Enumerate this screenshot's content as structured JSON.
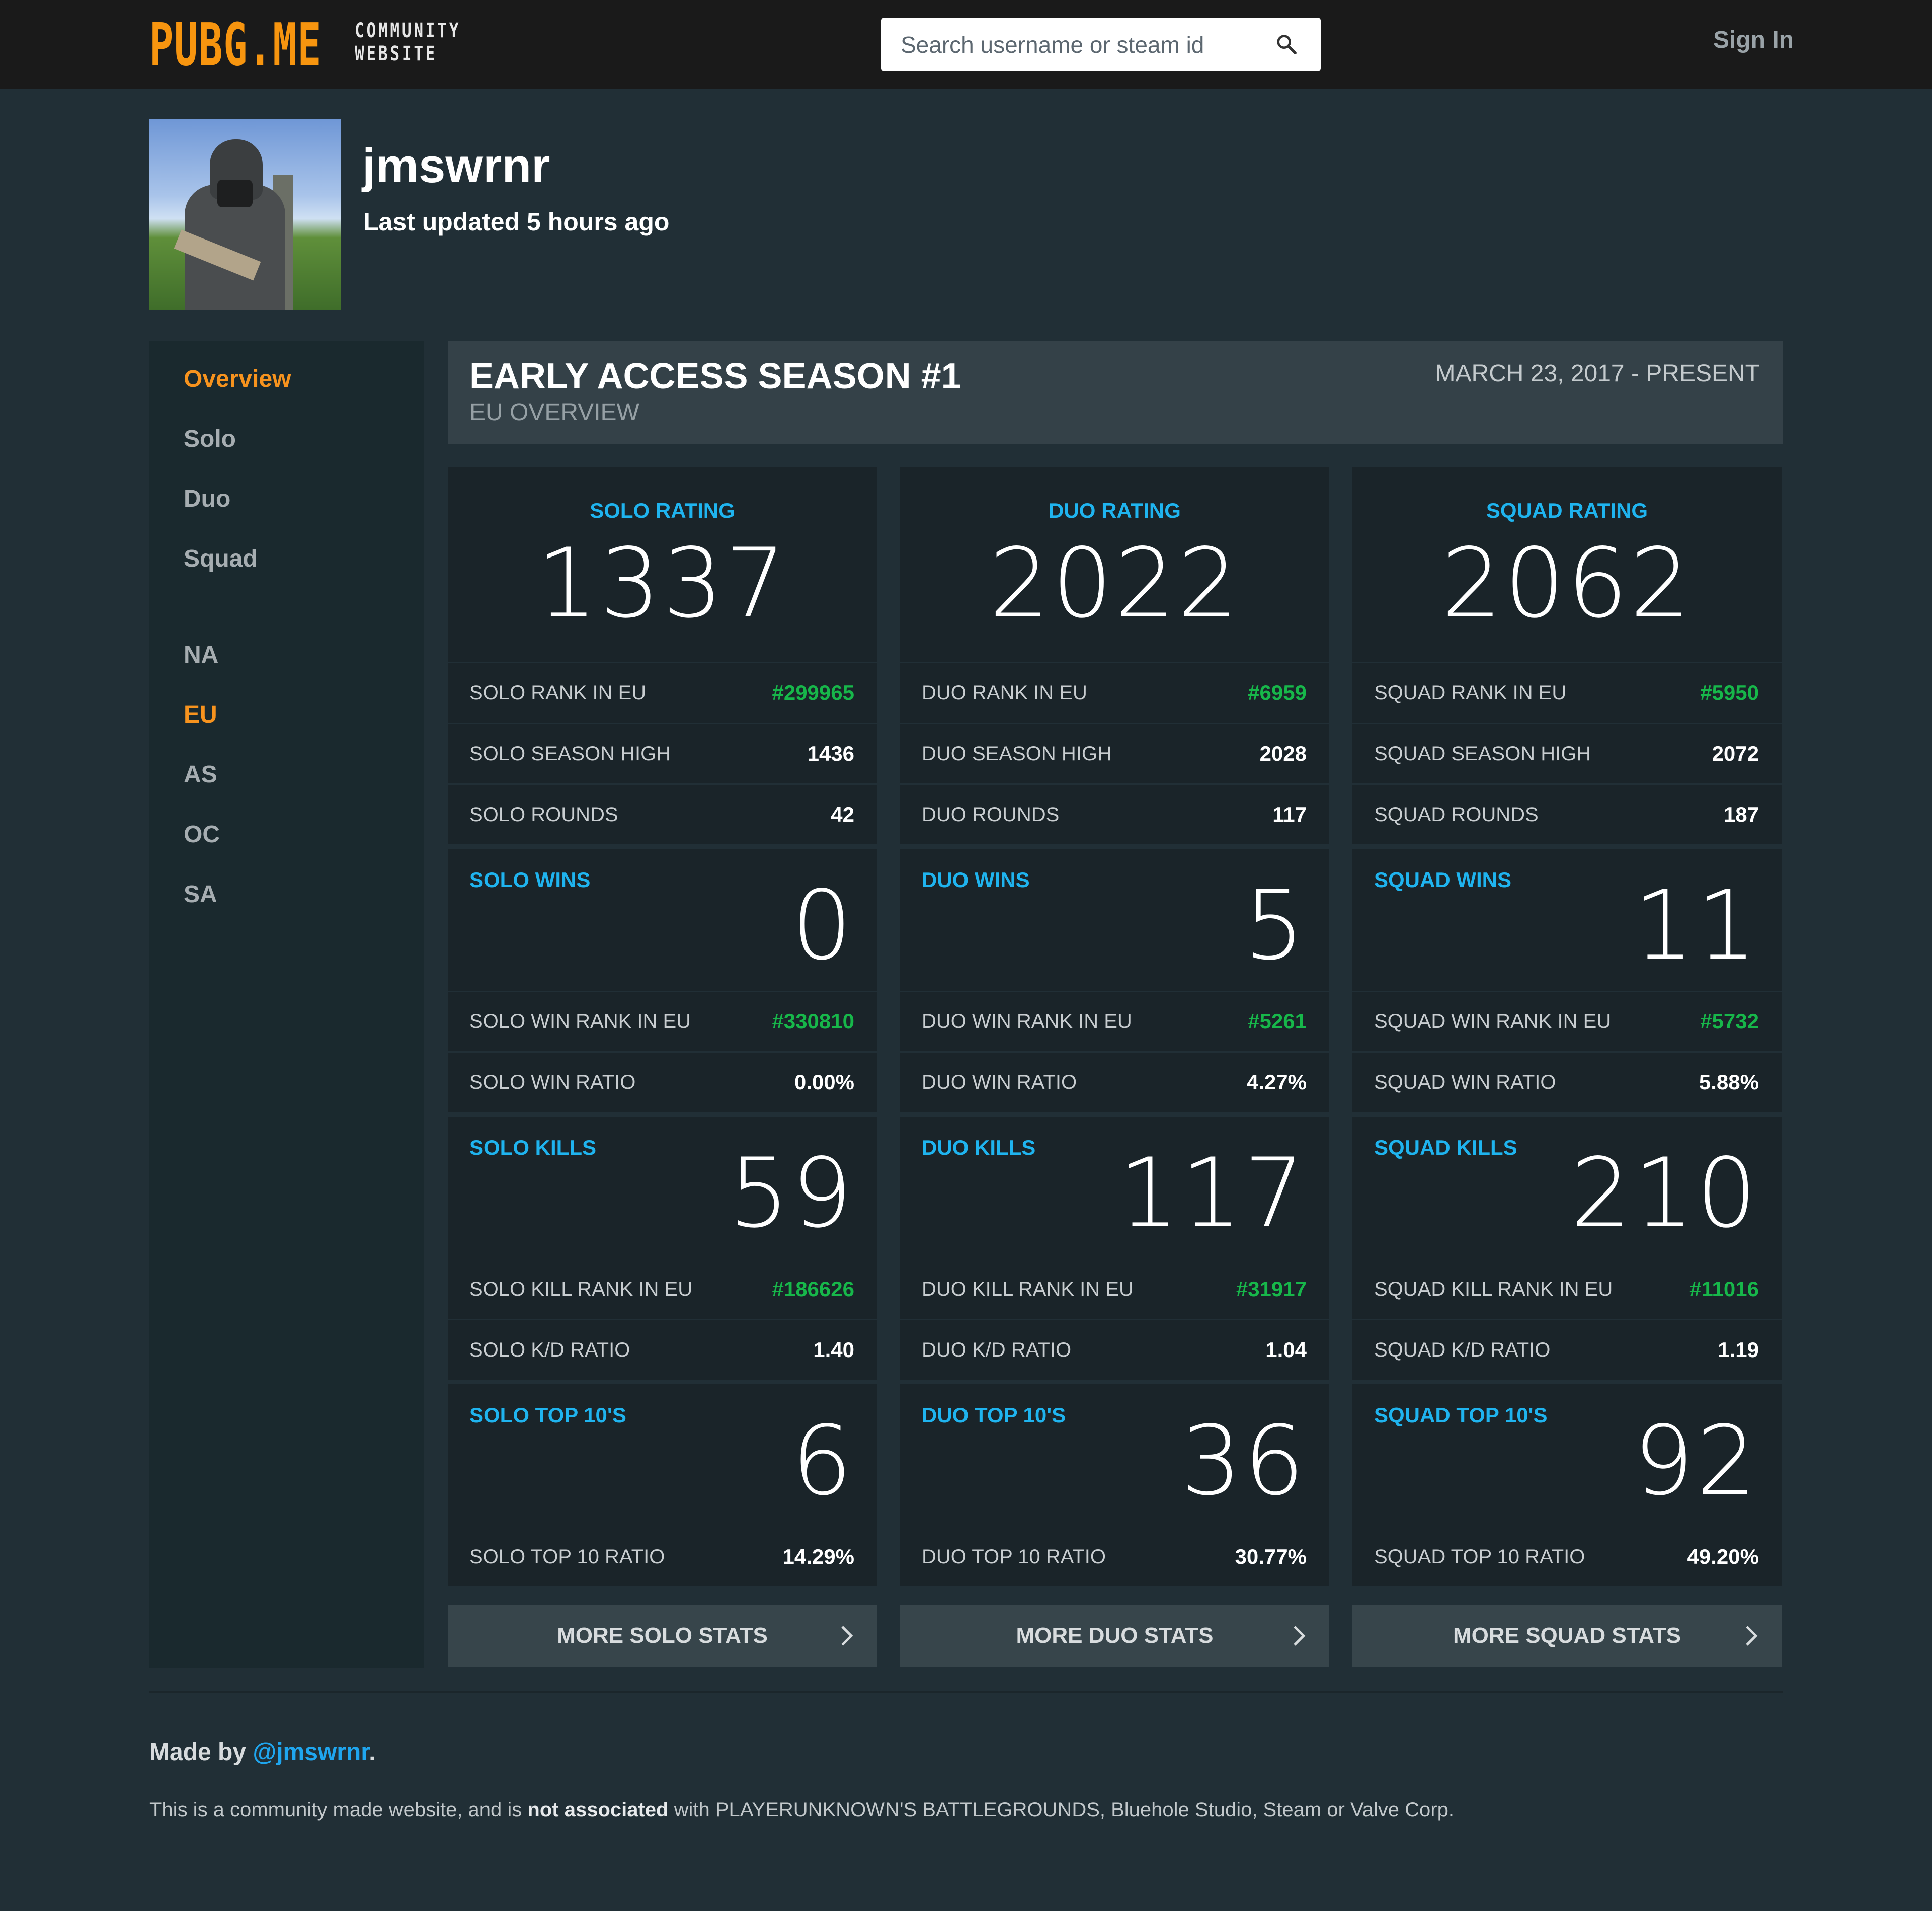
{
  "header": {
    "logo_main": "PUBG.ME",
    "logo_sub_line1": "COMMUNITY",
    "logo_sub_line2": "WEBSITE",
    "search_placeholder": "Search username or steam id",
    "search_icon": "search-icon",
    "sign_in": "Sign In"
  },
  "profile": {
    "username": "jmswrnr",
    "last_updated": "Last updated 5 hours ago"
  },
  "sidebar": {
    "modes": [
      {
        "label": "Overview",
        "active": true
      },
      {
        "label": "Solo",
        "active": false
      },
      {
        "label": "Duo",
        "active": false
      },
      {
        "label": "Squad",
        "active": false
      }
    ],
    "regions": [
      {
        "label": "NA",
        "active": false
      },
      {
        "label": "EU",
        "active": true
      },
      {
        "label": "AS",
        "active": false
      },
      {
        "label": "OC",
        "active": false
      },
      {
        "label": "SA",
        "active": false
      }
    ]
  },
  "season": {
    "title": "EARLY ACCESS SEASON #1",
    "subtitle": "EU OVERVIEW",
    "date_range": "MARCH 23, 2017 - PRESENT"
  },
  "colors": {
    "accent_orange": "#f7931e",
    "label_blue": "#1fb4ef",
    "rank_green": "#17b74a"
  },
  "columns": [
    {
      "rating_label": "SOLO RATING",
      "rating": "1337",
      "rating_rows": [
        {
          "label": "SOLO RANK IN EU",
          "value": "#299965"
        },
        {
          "label": "SOLO SEASON HIGH",
          "value": "1436"
        },
        {
          "label": "SOLO ROUNDS",
          "value": "42"
        }
      ],
      "wins_label": "SOLO WINS",
      "wins": "0",
      "wins_rows": [
        {
          "label": "SOLO WIN RANK IN EU",
          "value": "#330810"
        },
        {
          "label": "SOLO WIN RATIO",
          "value": "0.00%"
        }
      ],
      "kills_label": "SOLO KILLS",
      "kills": "59",
      "kills_rows": [
        {
          "label": "SOLO KILL RANK IN EU",
          "value": "#186626"
        },
        {
          "label": "SOLO K/D RATIO",
          "value": "1.40"
        }
      ],
      "top10_label": "SOLO TOP 10'S",
      "top10": "6",
      "top10_rows": [
        {
          "label": "SOLO TOP 10 RATIO",
          "value": "14.29%"
        }
      ],
      "more_button": "MORE SOLO STATS"
    },
    {
      "rating_label": "DUO RATING",
      "rating": "2022",
      "rating_rows": [
        {
          "label": "DUO RANK IN EU",
          "value": "#6959"
        },
        {
          "label": "DUO SEASON HIGH",
          "value": "2028"
        },
        {
          "label": "DUO ROUNDS",
          "value": "117"
        }
      ],
      "wins_label": "DUO WINS",
      "wins": "5",
      "wins_rows": [
        {
          "label": "DUO WIN RANK IN EU",
          "value": "#5261"
        },
        {
          "label": "DUO WIN RATIO",
          "value": "4.27%"
        }
      ],
      "kills_label": "DUO KILLS",
      "kills": "117",
      "kills_rows": [
        {
          "label": "DUO KILL RANK IN EU",
          "value": "#31917"
        },
        {
          "label": "DUO K/D RATIO",
          "value": "1.04"
        }
      ],
      "top10_label": "DUO TOP 10'S",
      "top10": "36",
      "top10_rows": [
        {
          "label": "DUO TOP 10 RATIO",
          "value": "30.77%"
        }
      ],
      "more_button": "MORE DUO STATS"
    },
    {
      "rating_label": "SQUAD RATING",
      "rating": "2062",
      "rating_rows": [
        {
          "label": "SQUAD RANK IN EU",
          "value": "#5950"
        },
        {
          "label": "SQUAD SEASON HIGH",
          "value": "2072"
        },
        {
          "label": "SQUAD ROUNDS",
          "value": "187"
        }
      ],
      "wins_label": "SQUAD WINS",
      "wins": "11",
      "wins_rows": [
        {
          "label": "SQUAD WIN RANK IN EU",
          "value": "#5732"
        },
        {
          "label": "SQUAD WIN RATIO",
          "value": "5.88%"
        }
      ],
      "kills_label": "SQUAD KILLS",
      "kills": "210",
      "kills_rows": [
        {
          "label": "SQUAD KILL RANK IN EU",
          "value": "#11016"
        },
        {
          "label": "SQUAD K/D RATIO",
          "value": "1.19"
        }
      ],
      "top10_label": "SQUAD TOP 10'S",
      "top10": "92",
      "top10_rows": [
        {
          "label": "SQUAD TOP 10 RATIO",
          "value": "49.20%"
        }
      ],
      "more_button": "MORE SQUAD STATS"
    }
  ],
  "footer": {
    "made_by_prefix": "Made by ",
    "made_by_link": "@jmswrnr",
    "made_by_suffix": ".",
    "disclaimer_part1": "This is a community made website, and is ",
    "disclaimer_bold": "not associated",
    "disclaimer_part2": " with PLAYERUNKNOWN'S BATTLEGROUNDS, Bluehole Studio, Steam or Valve Corp."
  }
}
